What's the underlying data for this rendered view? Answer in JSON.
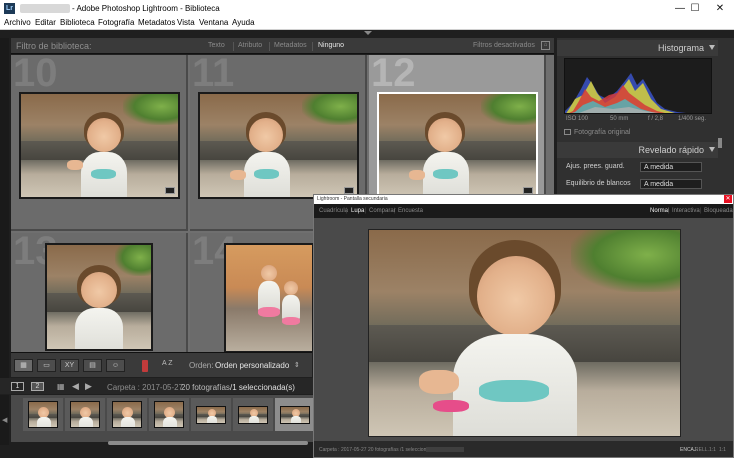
{
  "window": {
    "app_title": "- Adobe Photoshop Lightroom - Biblioteca",
    "logo": "Lr",
    "minimize": "—",
    "maximize": "☐",
    "close": "✕"
  },
  "menu": [
    "Archivo",
    "Editar",
    "Biblioteca",
    "Fotografía",
    "Metadatos",
    "Vista",
    "Ventana",
    "Ayuda"
  ],
  "filter_bar": {
    "label": "Filtro de biblioteca:",
    "options": [
      "Texto",
      "Atributo",
      "Metadatos",
      "Ninguno"
    ],
    "active": "Ninguno",
    "status": "Filtros desactivados"
  },
  "grid": {
    "cells": [
      {
        "number": "10",
        "selected": false
      },
      {
        "number": "11",
        "selected": false
      },
      {
        "number": "12",
        "selected": true
      },
      {
        "number": "13",
        "selected": false
      },
      {
        "number": "14",
        "selected": false
      }
    ]
  },
  "toolbar": {
    "sort_label": "Orden:",
    "sort_value": "Orden personalizado",
    "view_xy": "XY",
    "view_az": "A Z"
  },
  "filmstrip_header": {
    "screen1": "1",
    "screen2": "2",
    "folder": "Carpeta : 2017-05-27",
    "count": "20 fotografías",
    "selected": "/1 seleccionada(s)"
  },
  "right_panel": {
    "histogram_title": "Histograma",
    "iso": "ISO 100",
    "focal": "50 mm",
    "aperture": "f / 2,8",
    "shutter": "1/400 seg.",
    "original_photo": "Fotografía original",
    "quick_develop_title": "Revelado rápido",
    "rows": [
      {
        "key": "Ajus. prees. guard.",
        "value": "A medida"
      },
      {
        "key": "Equilibrio de blancos",
        "value": "A medida"
      }
    ]
  },
  "secondary_window": {
    "title": "Lightroom - Pantalla secundaria",
    "views": [
      "Cuadrícula",
      "Lupa",
      "Comparar",
      "Encuesta"
    ],
    "active_view": "Lupa",
    "modes": [
      "Normal",
      "Interactiva",
      "Bloqueada"
    ],
    "active_mode": "Normal",
    "status_folder": "Carpeta : 2017-05-27",
    "status_count": "20 fotografías /1 seleccionada(s) /",
    "status_zoom": [
      "ENCAJ.",
      "RELL.",
      "1:1",
      "1:1"
    ]
  },
  "colors": {
    "selected_cell": "#9a9a9a",
    "active_text": "#e8e8e8",
    "close_red": "#e81123"
  }
}
